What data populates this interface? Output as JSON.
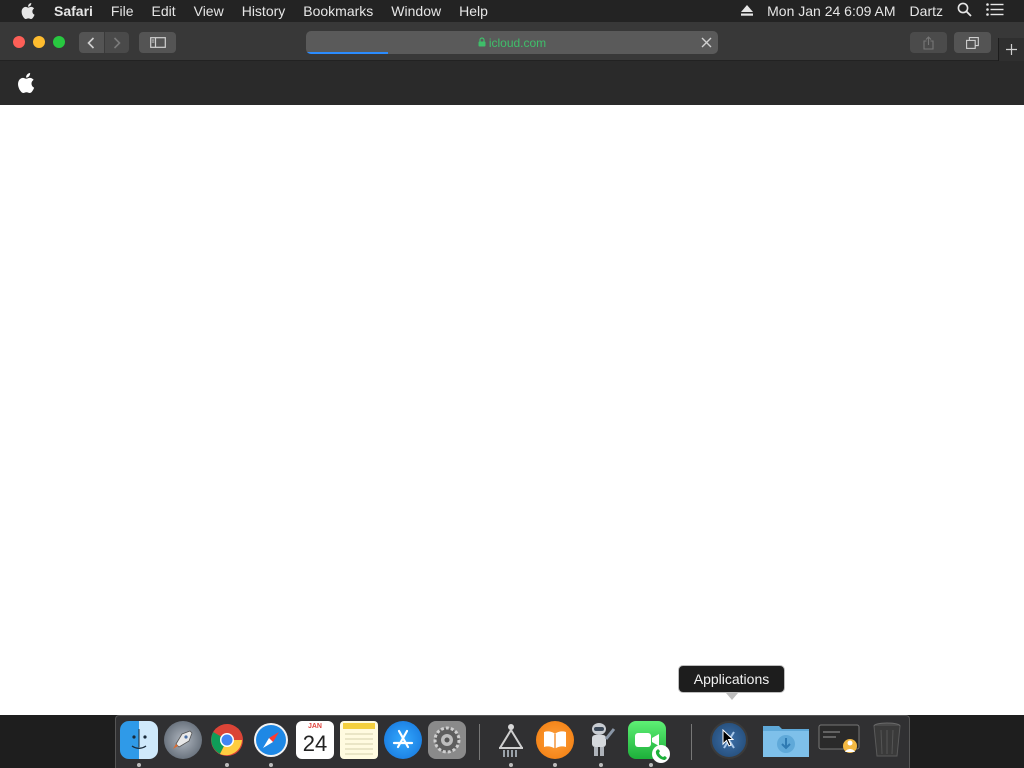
{
  "menubar": {
    "app_name": "Safari",
    "menus": [
      "File",
      "Edit",
      "View",
      "History",
      "Bookmarks",
      "Window",
      "Help"
    ],
    "clock": "Mon Jan 24  6:09 AM",
    "user": "Dartz"
  },
  "toolbar": {
    "url": "icloud.com",
    "load_progress": 0.2
  },
  "calendar": {
    "month": "JAN",
    "day": "24"
  },
  "tooltip": {
    "label": "Applications"
  },
  "colors": {
    "menubar_bg": "#232323",
    "toolbar_bg": "#383838",
    "url_green": "#3fbf6a",
    "progress_blue": "#2b8cff",
    "page_bg": "#ffffff"
  },
  "dock": {
    "items": [
      {
        "name": "finder-icon",
        "running": true
      },
      {
        "name": "launchpad-icon",
        "running": false
      },
      {
        "name": "chrome-icon",
        "running": true
      },
      {
        "name": "safari-icon",
        "running": true
      },
      {
        "name": "calendar-icon",
        "running": false
      },
      {
        "name": "notes-icon",
        "running": false
      },
      {
        "name": "app-store-icon",
        "running": false
      },
      {
        "name": "system-preferences-icon",
        "running": false
      },
      {
        "name": "directory-utility-icon",
        "running": true
      },
      {
        "name": "books-icon",
        "running": true
      },
      {
        "name": "automator-icon",
        "running": true
      },
      {
        "name": "facetime-icon",
        "running": true
      },
      {
        "name": "applications-folder-icon",
        "running": false
      },
      {
        "name": "downloads-folder-icon",
        "running": false
      },
      {
        "name": "network-folder-icon",
        "running": false
      },
      {
        "name": "trash-icon",
        "running": false
      }
    ]
  }
}
